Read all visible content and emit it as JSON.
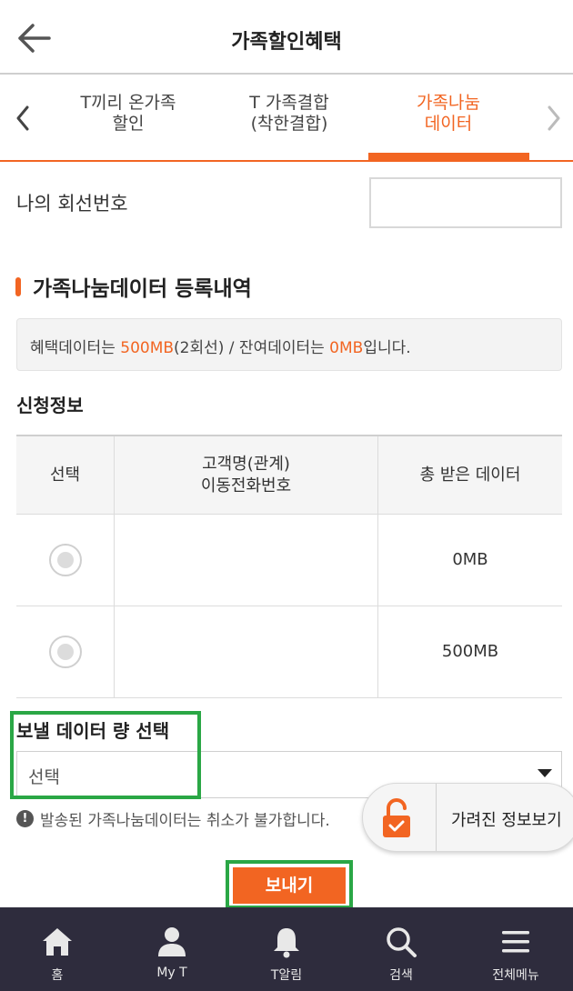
{
  "header": {
    "title": "가족할인혜택"
  },
  "tabs": [
    {
      "line1": "T끼리 온가족",
      "line2": "할인"
    },
    {
      "line1": "T 가족결합",
      "line2": "(착한결합)"
    },
    {
      "line1": "가족나눔",
      "line2": "데이터"
    }
  ],
  "line_label": "나의 회선번호",
  "line_value": "",
  "section_title": "가족나눔데이터 등록내역",
  "notice": {
    "p1": "혜택데이터는 ",
    "v1": "500MB",
    "p2": "(2회선) / 잔여데이터는 ",
    "v2": "0MB",
    "p3": "입니다."
  },
  "apply_title": "신청정보",
  "table": {
    "headers": {
      "select": "선택",
      "name_line1": "고객명(관계)",
      "name_line2": "이동전화번호",
      "total": "총 받은 데이터"
    },
    "rows": [
      {
        "name": "",
        "total": "0MB"
      },
      {
        "name": "",
        "total": "500MB"
      }
    ]
  },
  "send_amount_label": "보낼 데이터 량 선택",
  "select_value": "선택",
  "warning": "발송된 가족나눔데이터는 취소가 불가합니다.",
  "reveal_label": "가려진 정보보기",
  "send_button": "보내기",
  "nav": [
    "홈",
    "My T",
    "T알림",
    "검색",
    "전체메뉴"
  ],
  "colors": {
    "accent": "#f26522",
    "nav_bg": "#2e2c3d",
    "highlight_box": "#2aa745"
  }
}
